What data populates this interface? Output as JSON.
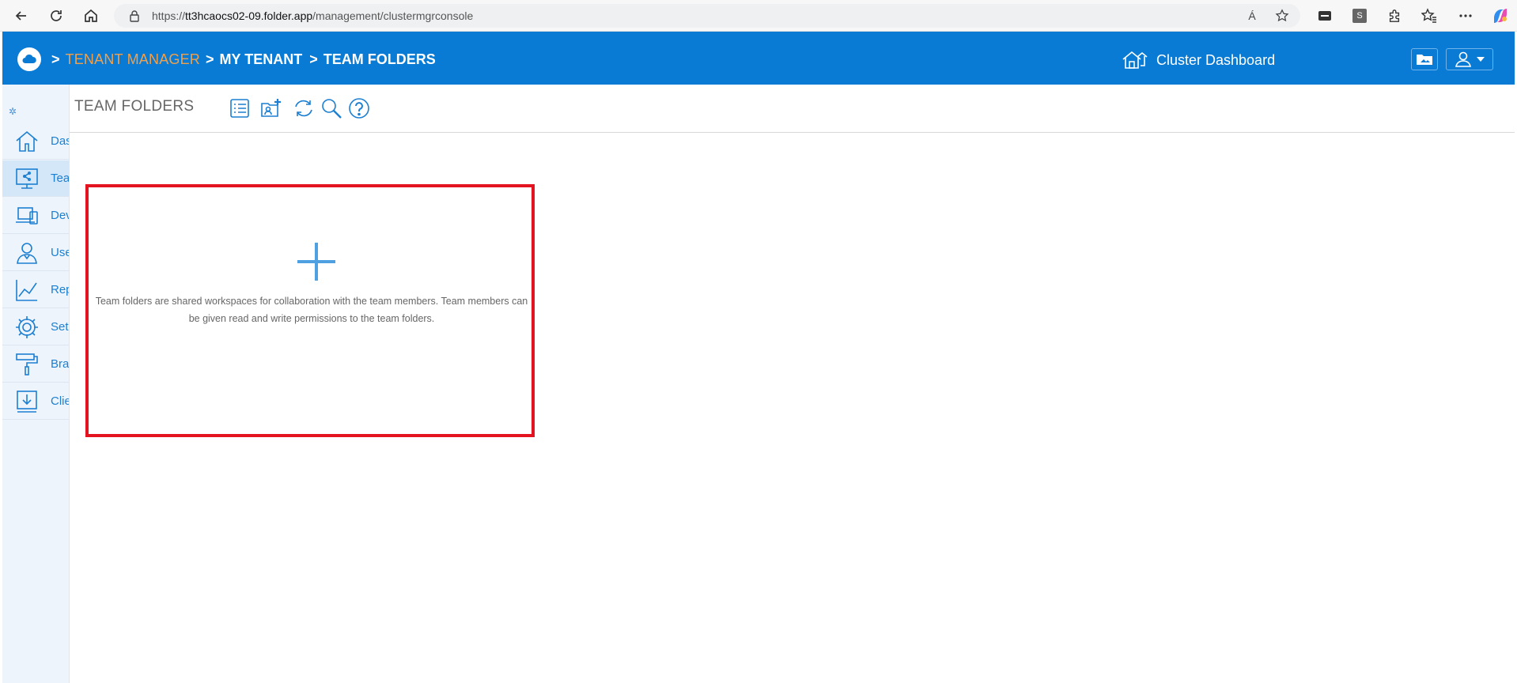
{
  "browser": {
    "url_scheme": "https://",
    "url_host": "tt3hcaocs02-09.folder.app",
    "url_path": "/management/clustermgrconsole",
    "read_aloud_label": "Á",
    "extension_s_label": "S"
  },
  "header": {
    "breadcrumb": {
      "sep1": ">",
      "item1": "TENANT MANAGER",
      "sep2": ">",
      "item2": "MY TENANT",
      "sep3": ">",
      "item3": "TEAM FOLDERS"
    },
    "cluster_dashboard_label": "Cluster Dashboard"
  },
  "sidebar": {
    "pin_glyph": "✲",
    "items": [
      {
        "label": "Das",
        "icon": "home-icon"
      },
      {
        "label": "Tea",
        "icon": "team-folder-icon"
      },
      {
        "label": "Dev",
        "icon": "devices-icon"
      },
      {
        "label": "Use",
        "icon": "user-icon"
      },
      {
        "label": "Rep",
        "icon": "chart-icon"
      },
      {
        "label": "Set",
        "icon": "gear-icon"
      },
      {
        "label": "Bra",
        "icon": "paint-roller-icon"
      },
      {
        "label": "Clie",
        "icon": "download-icon"
      }
    ]
  },
  "toolbar": {
    "title": "TEAM FOLDERS"
  },
  "empty_card": {
    "text": "Team folders are shared workspaces for collaboration with the team members. Team members can be given read and write permissions to the team folders."
  },
  "colors": {
    "header_bg": "#0a7bd5",
    "breadcrumb_active": "#f0a04a",
    "accent": "#1c7fd1",
    "highlight_border": "#e3141f"
  }
}
